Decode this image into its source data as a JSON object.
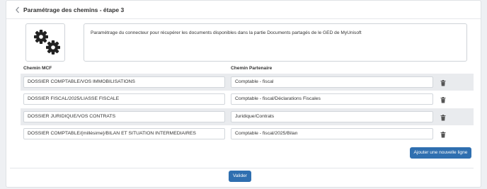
{
  "header": {
    "back_icon": "chevron-left-icon",
    "title": "Paramétrage des chemins - étape 3"
  },
  "info": {
    "icon": "gears-icon",
    "description": "Paramétrage du connecteur pour récupérer les documents disponibles dans la partie Documents partagés de le GED de MyUnisoft"
  },
  "table": {
    "columns": [
      "Chemin MCF",
      "Chemin Partenaire"
    ],
    "rows": [
      {
        "mcf": "DOSSIER COMPTABLE/VOS IMMOBILISATIONS",
        "partner": "Comptable - fiscal"
      },
      {
        "mcf": "DOSSIER FISCAL/2025/LIASSE FISCALE",
        "partner": "Comptable - fiscal/Déclarations Fiscales"
      },
      {
        "mcf": "DOSSIER JURIDIQUE/VOS CONTRATS",
        "partner": "Juridique/Contrats"
      },
      {
        "mcf": "DOSSIER COMPTABLE/{millésime}/BILAN ET SITUATION INTERMEDIAIRES",
        "partner": "Comptable - fiscal/2025/Bilan"
      }
    ],
    "delete_icon": "trash-icon"
  },
  "actions": {
    "add_label": "Ajouter une nouvelle ligne",
    "validate_label": "Valider"
  },
  "colors": {
    "primary": "#2f6fb0",
    "row_shade": "#e9ebee"
  }
}
